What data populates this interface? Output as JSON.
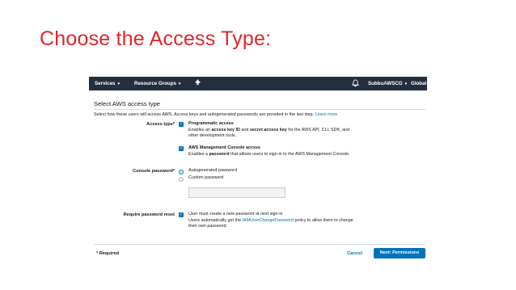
{
  "slide": {
    "title": "Choose the Access Type:"
  },
  "navbar": {
    "services": "Services",
    "resource_groups": "Resource Groups",
    "account": "SubbuAWSCG",
    "region": "Global"
  },
  "page": {
    "section_title": "Select AWS access type",
    "intro": "Select how these users will access AWS. Access keys and autogenerated passwords are provided in the last step.",
    "learn_more": "Learn more"
  },
  "access_type": {
    "label": "Access type*",
    "programmatic": {
      "checked": true,
      "title": "Programmatic access",
      "desc_pre": "Enables an ",
      "desc_b1": "access key ID",
      "desc_mid": " and ",
      "desc_b2": "secret access key",
      "desc_post": " for the AWS API, CLI, SDK, and",
      "desc_line2": "other development tools."
    },
    "console": {
      "checked": true,
      "title": "AWS Management Console access",
      "desc_pre": "Enables a ",
      "desc_b": "password",
      "desc_post": " that allows users to sign-in to the AWS Management Console."
    }
  },
  "console_password": {
    "label": "Console password*",
    "options": [
      "Autogenerated password",
      "Custom password"
    ],
    "selected": "Autogenerated password",
    "custom_value": ""
  },
  "password_reset": {
    "label": "Require password reset",
    "checked": true,
    "line1": "User must create a new password at next sign-in",
    "line2_pre": "Users automatically get the ",
    "policy_link": "IAMUserChangePassword",
    "line2_post": " policy to allow them to change",
    "line3": "their own password."
  },
  "footer": {
    "required": "* Required",
    "cancel": "Cancel",
    "next": "Next: Permissions"
  },
  "colors": {
    "title_red": "#e0262b",
    "navbar_bg": "#232f3e",
    "primary_blue": "#0073bb"
  }
}
